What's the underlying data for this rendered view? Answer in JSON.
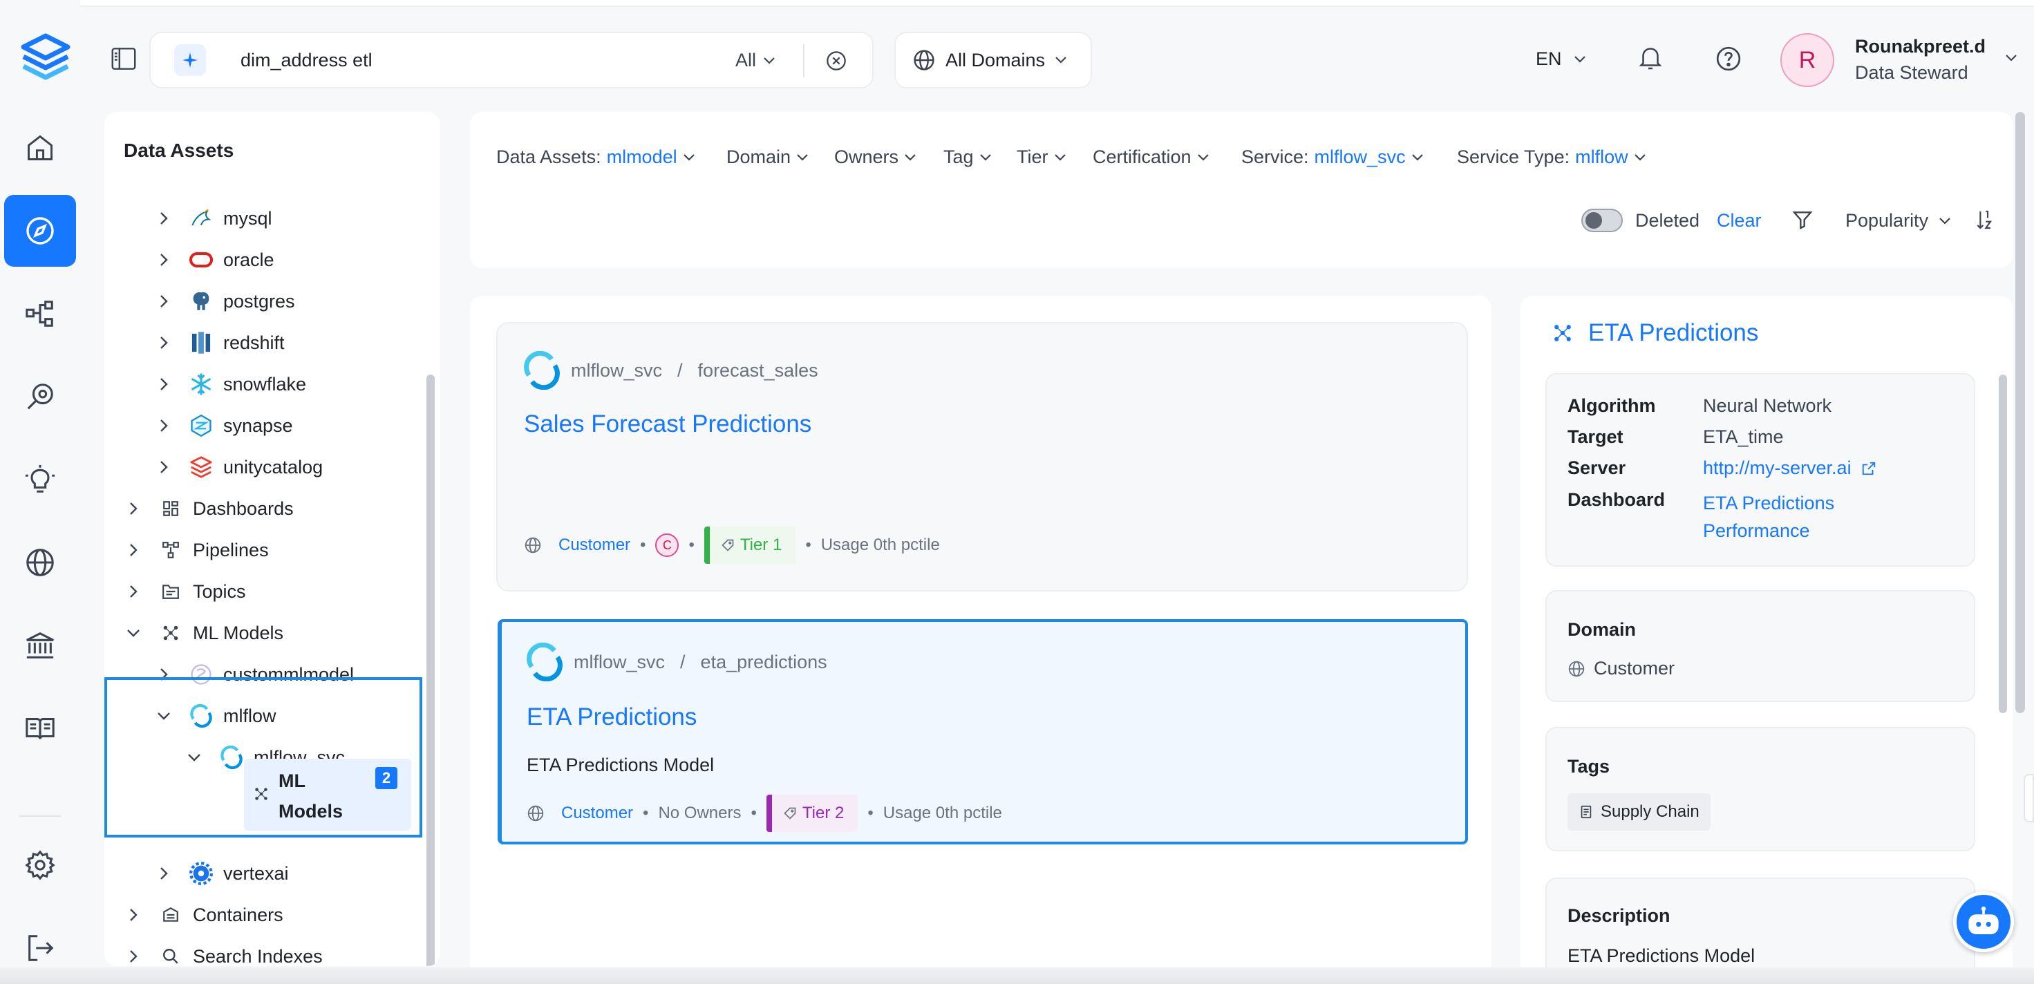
{
  "header": {
    "search_value": "dim_address etl",
    "search_scope": "All",
    "domain_selector": "All Domains",
    "language": "EN",
    "user_initial": "R",
    "user_name": "Rounakpreet.d",
    "user_role": "Data Steward"
  },
  "tree": {
    "title": "Data Assets",
    "nodes": [
      {
        "label": "mysql"
      },
      {
        "label": "oracle"
      },
      {
        "label": "postgres"
      },
      {
        "label": "redshift"
      },
      {
        "label": "snowflake"
      },
      {
        "label": "synapse"
      },
      {
        "label": "unitycatalog"
      },
      {
        "label": "Dashboards"
      },
      {
        "label": "Pipelines"
      },
      {
        "label": "Topics"
      },
      {
        "label": "ML Models"
      },
      {
        "label": "custommlmodel"
      },
      {
        "label": "mlflow"
      },
      {
        "label": "mlflow_svc"
      },
      {
        "label": "ML Models",
        "count": "2"
      },
      {
        "label": "vertexai"
      },
      {
        "label": "Containers"
      },
      {
        "label": "Search Indexes"
      }
    ]
  },
  "filters": {
    "data_assets_label": "Data Assets:",
    "data_assets_value": "mlmodel",
    "domain": "Domain",
    "owners": "Owners",
    "tag": "Tag",
    "tier": "Tier",
    "certification": "Certification",
    "service_label": "Service:",
    "service_value": "mlflow_svc",
    "service_type_label": "Service Type:",
    "service_type_value": "mlflow",
    "deleted": "Deleted",
    "clear": "Clear",
    "sort": "Popularity"
  },
  "results": [
    {
      "service": "mlflow_svc",
      "separator": "/",
      "name": "forecast_sales",
      "title": "Sales Forecast Predictions",
      "description": "",
      "domain": "Customer",
      "owner_initial": "C",
      "tier": "Tier 1",
      "usage": "Usage 0th pctile"
    },
    {
      "service": "mlflow_svc",
      "separator": "/",
      "name": "eta_predictions",
      "title": "ETA Predictions",
      "description": "ETA Predictions Model",
      "domain": "Customer",
      "owners": "No Owners",
      "tier": "Tier 2",
      "usage": "Usage 0th pctile"
    }
  ],
  "detail": {
    "title": "ETA Predictions",
    "props": {
      "algorithm_label": "Algorithm",
      "algorithm": "Neural Network",
      "target_label": "Target",
      "target": "ETA_time",
      "server_label": "Server",
      "server": "http://my-server.ai",
      "dashboard_label": "Dashboard",
      "dashboard_line1": "ETA Predictions",
      "dashboard_line2": "Performance"
    },
    "domain_label": "Domain",
    "domain": "Customer",
    "tags_label": "Tags",
    "tag": "Supply Chain",
    "description_label": "Description",
    "description": "ETA Predictions Model"
  },
  "colors": {
    "accent": "#1677ff",
    "tier1": "#2fb344",
    "tier2": "#9c27b0",
    "selected_outline": "#1e88e5"
  }
}
